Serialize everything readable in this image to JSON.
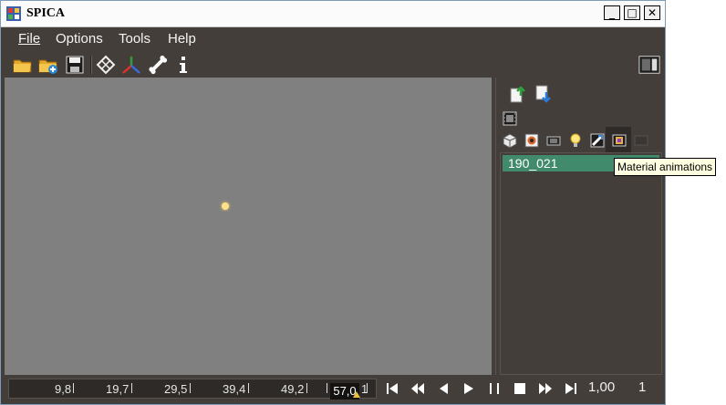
{
  "window": {
    "title": "SPICA",
    "controls": {
      "minimize": "_",
      "maximize": "□",
      "close": "✕"
    }
  },
  "menu": [
    {
      "label": "File",
      "mnemonic_underlined": true
    },
    {
      "label": "Options",
      "mnemonic_underlined": true
    },
    {
      "label": "Tools",
      "mnemonic_underlined": false
    },
    {
      "label": "Help",
      "mnemonic_underlined": true
    }
  ],
  "toolbar": {
    "icons": [
      "open-folder-icon",
      "import-folder-icon",
      "save-icon",
      "grid-icon",
      "axis-icon",
      "bone-icon",
      "info-icon"
    ],
    "right_icon": "panel-toggle-icon"
  },
  "side_panel": {
    "icons_row1": [
      "export-up-icon",
      "import-down-icon"
    ],
    "icons_row2": [
      "film-icon"
    ],
    "icons_row3": [
      "model-cube-icon",
      "texture-icon",
      "camera-icon",
      "light-bulb-icon",
      "skeletal-animation-icon",
      "material-animation-icon",
      "disabled-icon"
    ],
    "list_items": [
      "190_021"
    ],
    "tooltip": "Material animations"
  },
  "timeline": {
    "tick_labels": [
      "9,8",
      "19,7",
      "29,5",
      "39,4",
      "49,2"
    ],
    "current_time": "57,0",
    "max_label": "1"
  },
  "playback": {
    "controls": [
      "skip-to-start-icon",
      "rewind-icon",
      "step-back-icon",
      "play-icon",
      "pause-icon",
      "stop-icon",
      "fast-forward-icon",
      "skip-to-end-icon"
    ],
    "speed": "1,00",
    "frame": "1"
  },
  "colors": {
    "background": "#433e3a",
    "viewport": "#808080",
    "selection": "#418a6b",
    "light": "#ffe08a"
  }
}
